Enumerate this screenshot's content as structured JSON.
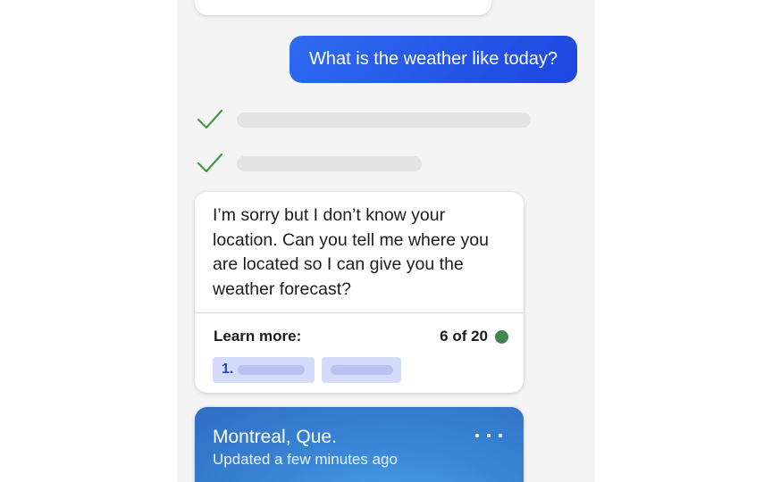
{
  "user_message": "What is the weather like today?",
  "progress_steps": [
    {
      "status": "done",
      "icon": "check-icon"
    },
    {
      "status": "done",
      "icon": "check-icon"
    }
  ],
  "bot_card": {
    "message": "I’m sorry but I don’t know your location. Can you tell me where you are located so I can give you the weather forecast?",
    "learn_more_label": "Learn more:",
    "counter": "6 of 20",
    "sources": [
      {
        "index": "1."
      },
      {
        "index": ""
      }
    ]
  },
  "weather_card": {
    "city": "Montreal, Que.",
    "updated": "Updated a few minutes ago",
    "more_icon": "more-horizontal-icon"
  },
  "colors": {
    "user_bubble": "#2a5ee8",
    "check": "#3f9a3f",
    "status_dot": "#3f8650",
    "chip": "#d5dcfb",
    "weather_card": "#3a86d6"
  }
}
